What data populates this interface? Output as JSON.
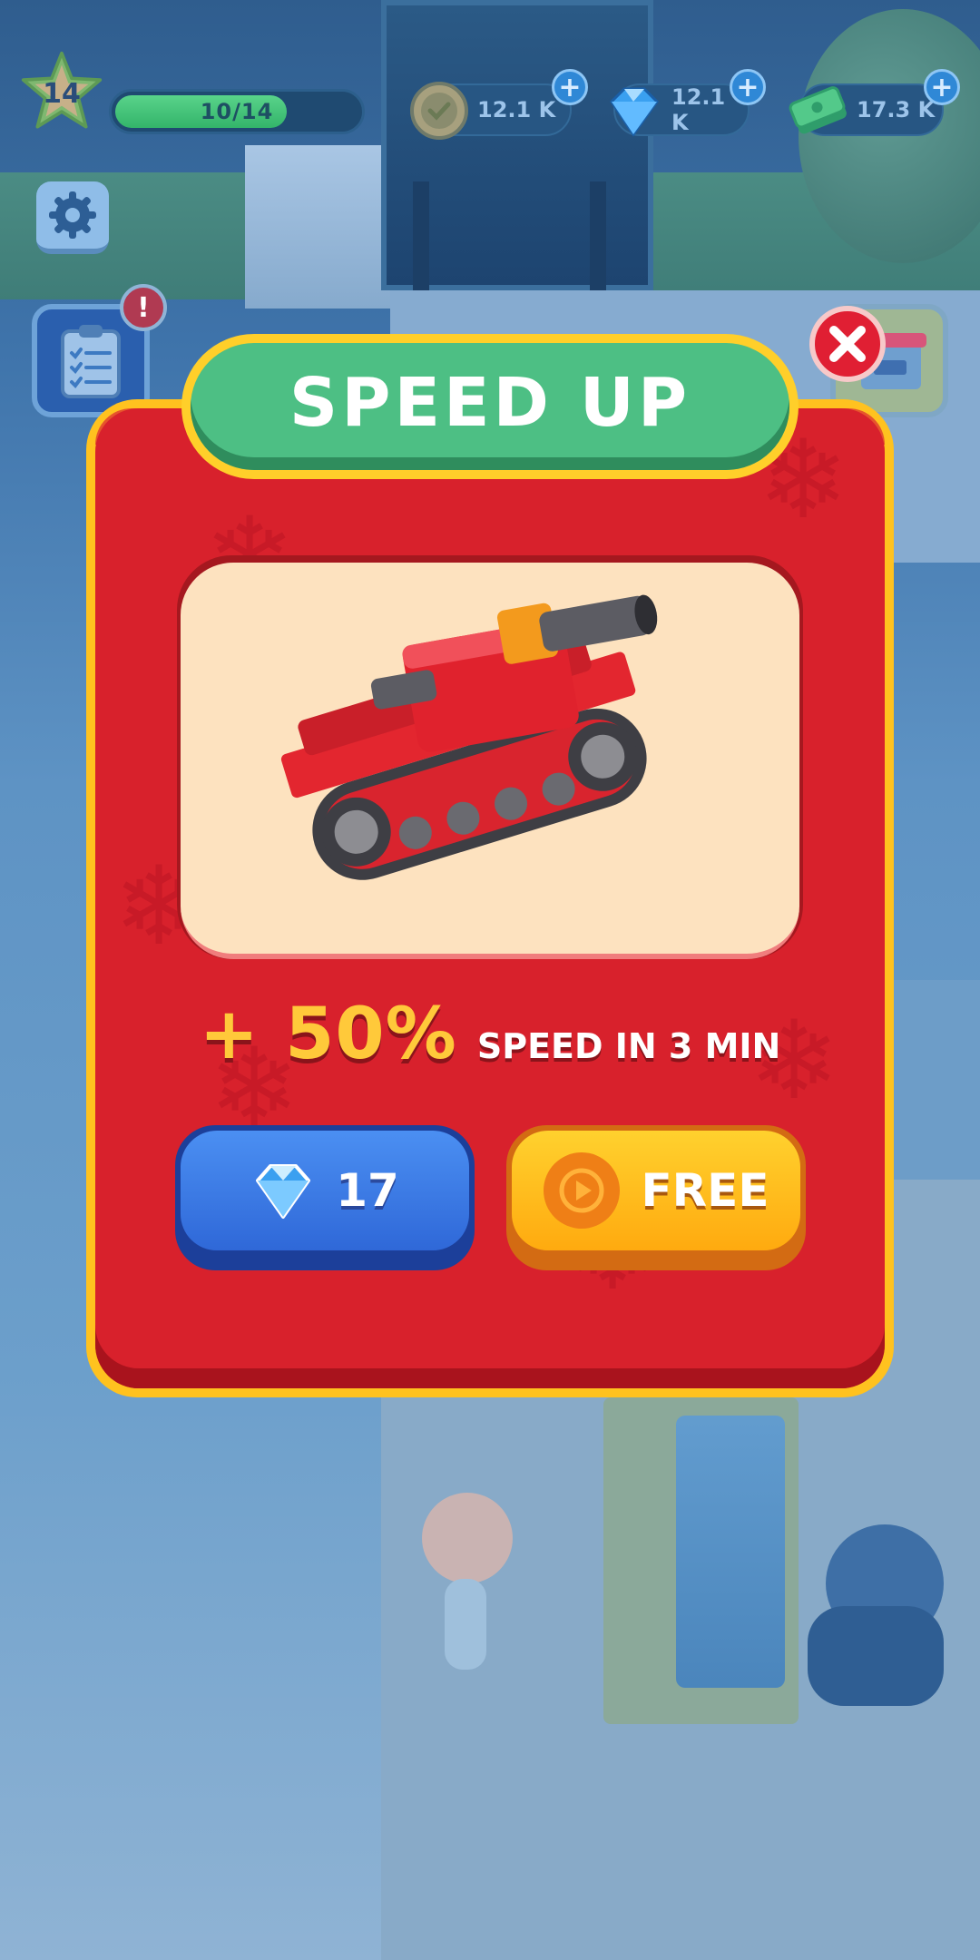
{
  "hud": {
    "level": "14",
    "xp_text": "10/14",
    "xp_progress": 0.714,
    "currencies": [
      {
        "name": "coins",
        "icon": "coin-icon",
        "amount": "12.1 K"
      },
      {
        "name": "gems",
        "icon": "gem-icon",
        "amount": "12.1 K"
      },
      {
        "name": "cash",
        "icon": "cash-icon",
        "amount": "17.3 K"
      }
    ],
    "settings_icon": "gear-icon",
    "quest_icon": "clipboard-icon",
    "quest_badge": "!",
    "shop_icon": "shop-icon"
  },
  "modal": {
    "title": "SPEED UP",
    "close_icon": "close-icon",
    "bonus_value": "+ 50%",
    "bonus_desc": "SPEED IN 3 MIN",
    "gem_cost": "17",
    "free_label": "FREE"
  },
  "colors": {
    "modal_red": "#d8212c",
    "modal_border": "#ffc21f",
    "title_green": "#4dbf84",
    "gem_button": "#2f68d8",
    "free_button": "#ffaa0f",
    "bonus_yellow": "#ffc93a"
  }
}
